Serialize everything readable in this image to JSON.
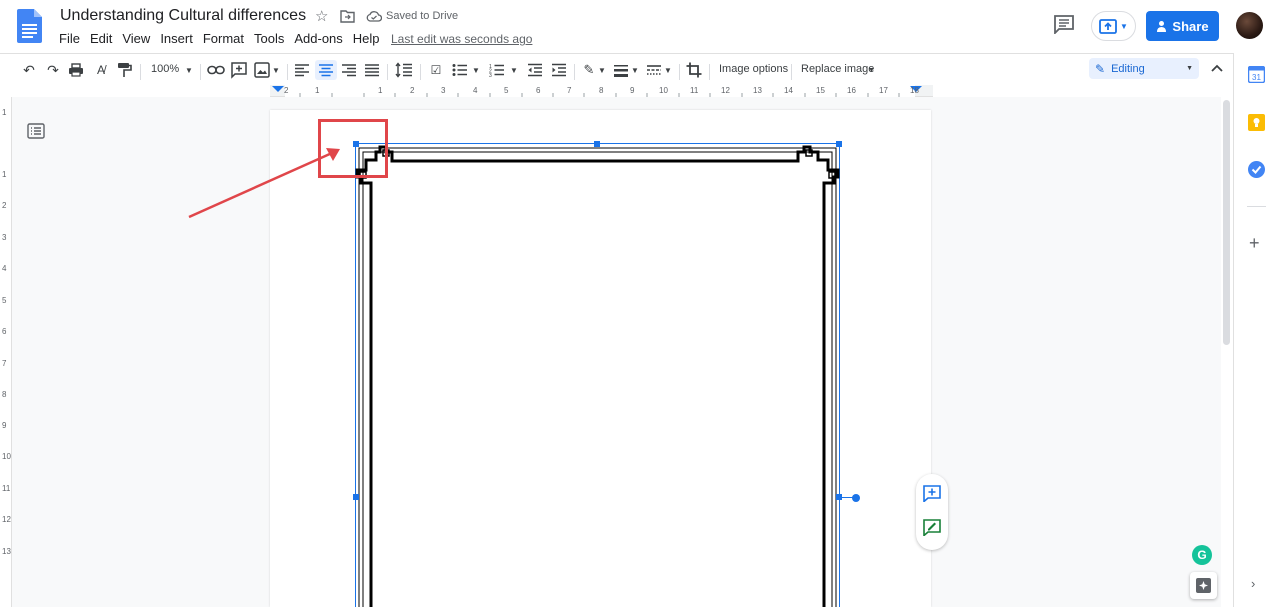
{
  "header": {
    "title": "Understanding Cultural differences",
    "saved_status": "Saved to Drive",
    "last_edit": "Last edit was seconds ago",
    "share_label": "Share"
  },
  "menu": [
    "File",
    "Edit",
    "View",
    "Insert",
    "Format",
    "Tools",
    "Add-ons",
    "Help"
  ],
  "toolbar": {
    "zoom": "100%",
    "image_options": "Image options",
    "replace_image": "Replace image",
    "mode": "Editing"
  },
  "ruler": {
    "h_labels": [
      "2",
      "1",
      "1",
      "2",
      "3",
      "4",
      "5",
      "6",
      "7",
      "8",
      "9",
      "10",
      "11",
      "12",
      "13",
      "14",
      "15",
      "16",
      "17",
      "18"
    ],
    "v_labels": [
      "1",
      "1",
      "2",
      "3",
      "4",
      "5",
      "6",
      "7",
      "8",
      "9",
      "10",
      "11",
      "12",
      "13"
    ]
  },
  "colors": {
    "accent": "#1a73e8",
    "annotation": "#e0464a",
    "selection": "#1a73e8"
  },
  "icons": [
    "docs-icon",
    "star-icon",
    "folder-move-icon",
    "cloud-saved-icon",
    "comment-icon",
    "present-icon",
    "share-lock-icon",
    "undo-icon",
    "redo-icon",
    "print-icon",
    "spellcheck-icon",
    "paint-format-icon",
    "link-icon",
    "add-comment-icon",
    "insert-image-icon",
    "align-left-icon",
    "align-center-icon",
    "align-right-icon",
    "justify-icon",
    "line-spacing-icon",
    "checklist-icon",
    "bulleted-list-icon",
    "numbered-list-icon",
    "decrease-indent-icon",
    "increase-indent-icon",
    "border-color-icon",
    "border-weight-icon",
    "border-dash-icon",
    "crop-icon",
    "pencil-icon",
    "calendar-icon",
    "keep-icon",
    "tasks-icon",
    "plus-icon",
    "grammarly-icon",
    "explore-icon"
  ]
}
